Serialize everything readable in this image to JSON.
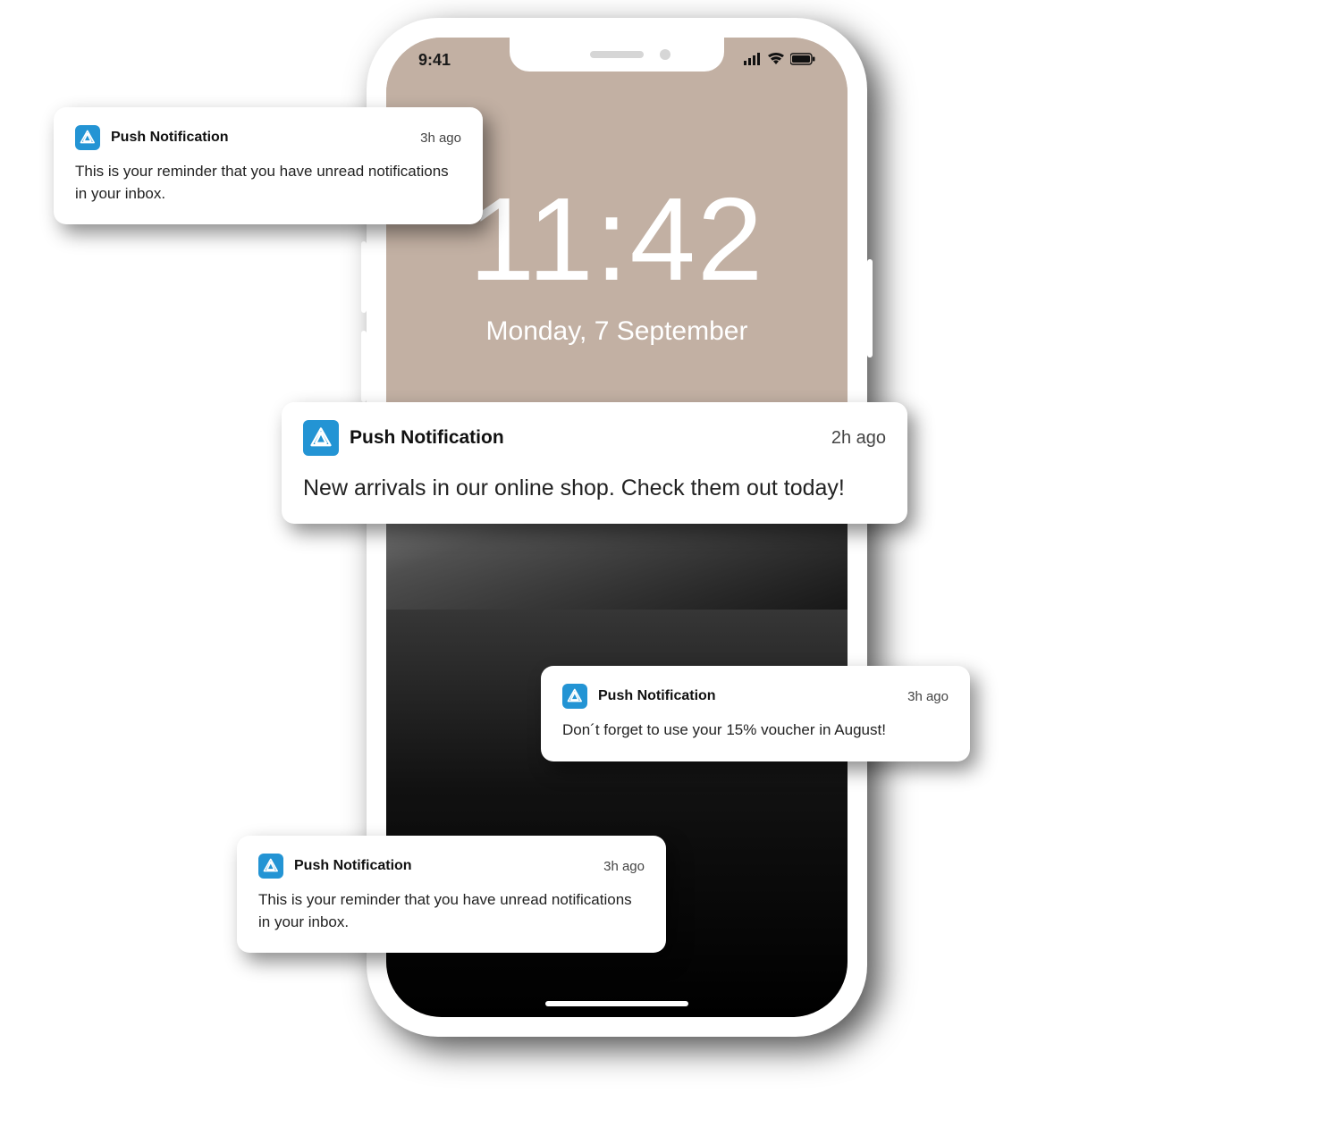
{
  "phone": {
    "status_time": "9:41",
    "clock_time": "11:42",
    "clock_date": "Monday, 7 September"
  },
  "notifications": [
    {
      "title": "Push Notification",
      "time": "3h ago",
      "body": "This is your reminder that you have unread notifications in your inbox."
    },
    {
      "title": "Push Notification",
      "time": "2h ago",
      "body": "New arrivals in our online shop. Check them out today!"
    },
    {
      "title": "Push Notification",
      "time": "3h ago",
      "body": "Don´t forget to use your 15% voucher in August!"
    },
    {
      "title": "Push Notification",
      "time": "3h ago",
      "body": "This is your reminder that you have unread notifications in your inbox."
    }
  ]
}
